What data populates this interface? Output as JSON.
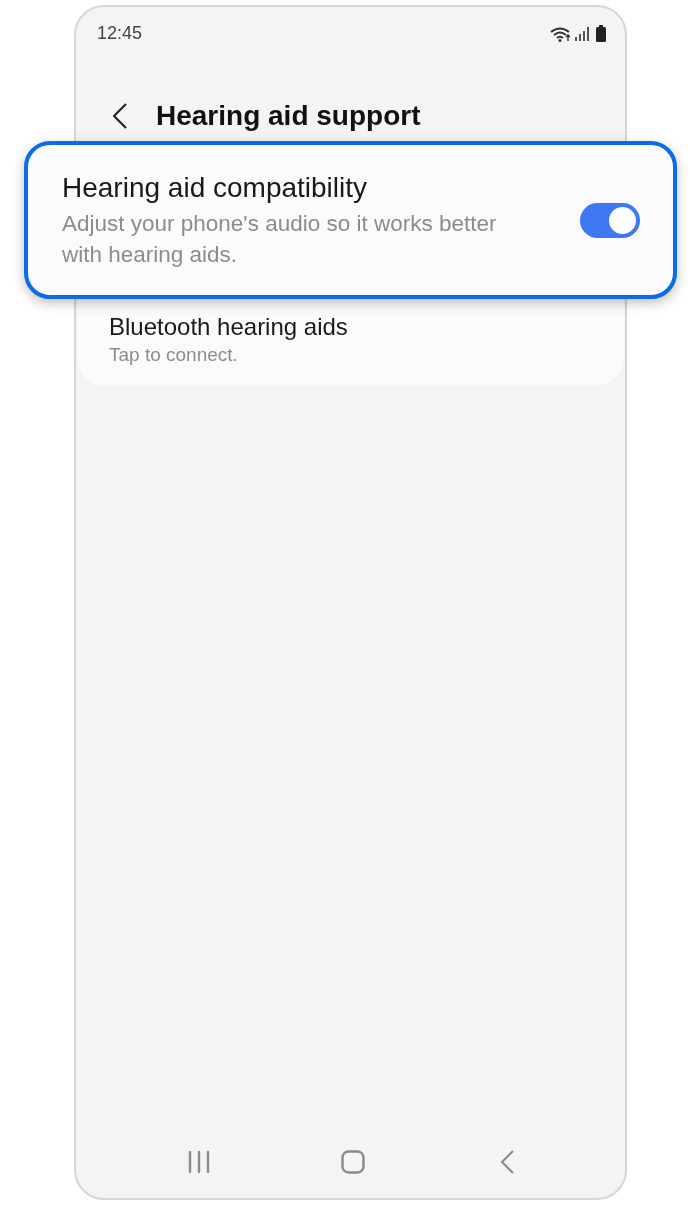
{
  "status_bar": {
    "time": "12:45"
  },
  "header": {
    "title": "Hearing aid support"
  },
  "settings": [
    {
      "kind": "toggle",
      "title": "Hearing aid compatibility",
      "subtitle": "Adjust your phone's audio so it works better with hearing aids.",
      "on": true,
      "highlighted": true
    },
    {
      "kind": "link",
      "title": "Bluetooth hearing aids",
      "subtitle": "Tap to connect.",
      "highlighted": false
    }
  ]
}
